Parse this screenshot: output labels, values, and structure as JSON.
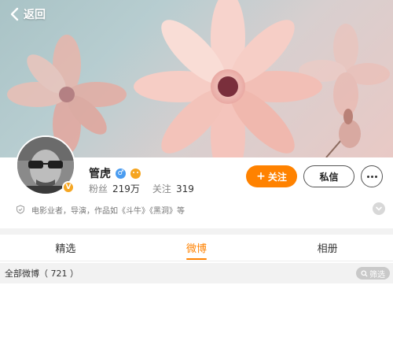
{
  "nav": {
    "back_label": "返回"
  },
  "profile": {
    "name": "管虎",
    "verified_badge": "V",
    "gender_icon": "♂",
    "fans_label": "粉丝",
    "fans_count": "219万",
    "following_label": "关注",
    "following_count": "319"
  },
  "actions": {
    "follow_plus": "+",
    "follow_label": "关注",
    "message_label": "私信"
  },
  "intro": {
    "text": "电影业者，导演，作品如《斗牛》《黑洞》等"
  },
  "tabs": [
    {
      "label": "精选",
      "active": false
    },
    {
      "label": "微博",
      "active": true
    },
    {
      "label": "相册",
      "active": false
    }
  ],
  "feed_filter": {
    "all_label": "全部微博（ 721 ）",
    "filter_label": "筛选"
  },
  "colors": {
    "accent": "#ff8200",
    "verified": "#f5a623",
    "gender_male": "#4a9cf0"
  },
  "icons": [
    "chevron-left-icon",
    "verified-icon",
    "male-gender-icon",
    "emoji-icon",
    "plus-icon",
    "more-icon",
    "shield-icon",
    "chevron-down-icon",
    "search-icon"
  ]
}
